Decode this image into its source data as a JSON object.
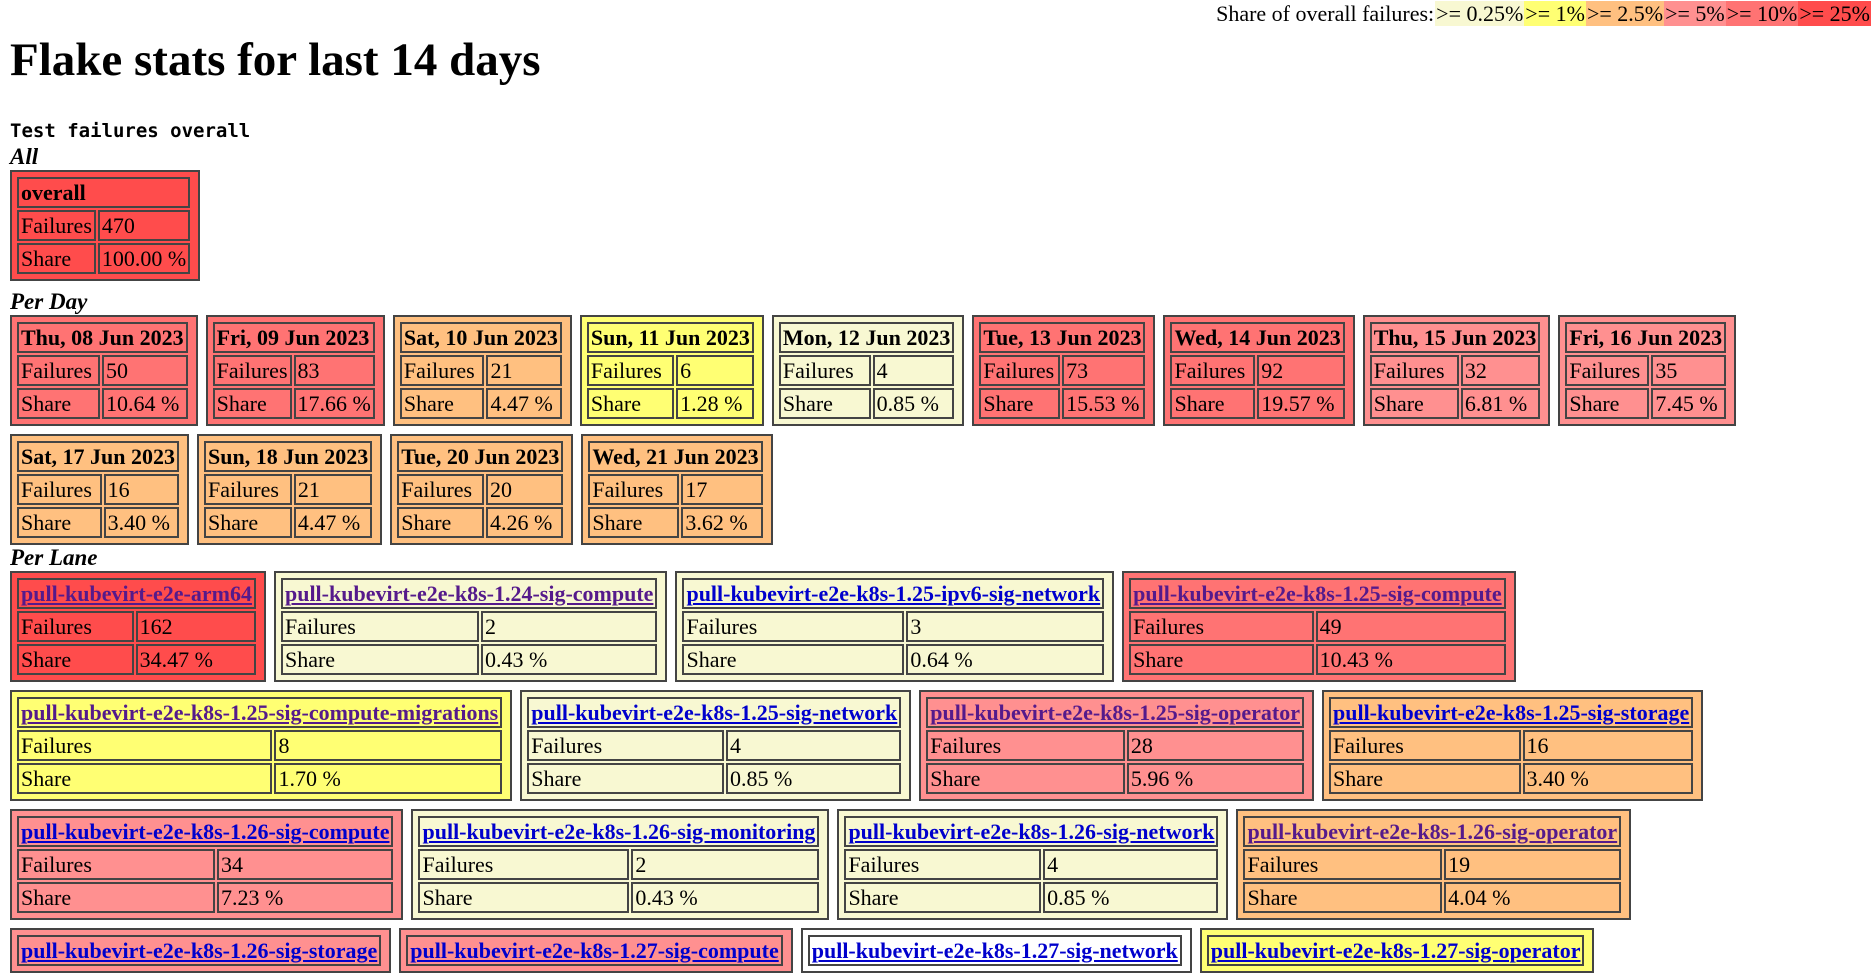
{
  "legend": {
    "label": "Share of overall failures:",
    "items": [
      {
        "label": ">= 0.25%",
        "color": "#f8f8d2"
      },
      {
        "label": ">= 1%",
        "color": "#ffff73"
      },
      {
        "label": ">= 2.5%",
        "color": "#ffc080"
      },
      {
        "label": ">= 5%",
        "color": "#ff9090"
      },
      {
        "label": ">= 10%",
        "color": "#ff7373"
      },
      {
        "label": ">= 25%",
        "color": "#ff4c4c"
      }
    ]
  },
  "title": "Flake stats for last 14 days",
  "subtitle": "Test failures overall",
  "labels": {
    "failures": "Failures",
    "share": "Share"
  },
  "sections": {
    "all": {
      "label": "All",
      "cards": [
        {
          "title": "overall",
          "failures": "470",
          "share": "100.00 %",
          "level": 6
        }
      ]
    },
    "per_day": {
      "label": "Per Day",
      "cards": [
        {
          "title": "Thu, 08 Jun 2023",
          "failures": "50",
          "share": "10.64 %",
          "level": 5
        },
        {
          "title": "Fri, 09 Jun 2023",
          "failures": "83",
          "share": "17.66 %",
          "level": 5
        },
        {
          "title": "Sat, 10 Jun 2023",
          "failures": "21",
          "share": "4.47 %",
          "level": 3
        },
        {
          "title": "Sun, 11 Jun 2023",
          "failures": "6",
          "share": "1.28 %",
          "level": 2
        },
        {
          "title": "Mon, 12 Jun 2023",
          "failures": "4",
          "share": "0.85 %",
          "level": 1
        },
        {
          "title": "Tue, 13 Jun 2023",
          "failures": "73",
          "share": "15.53 %",
          "level": 5
        },
        {
          "title": "Wed, 14 Jun 2023",
          "failures": "92",
          "share": "19.57 %",
          "level": 5
        },
        {
          "title": "Thu, 15 Jun 2023",
          "failures": "32",
          "share": "6.81 %",
          "level": 4
        },
        {
          "title": "Fri, 16 Jun 2023",
          "failures": "35",
          "share": "7.45 %",
          "level": 4
        },
        {
          "title": "Sat, 17 Jun 2023",
          "failures": "16",
          "share": "3.40 %",
          "level": 3
        },
        {
          "title": "Sun, 18 Jun 2023",
          "failures": "21",
          "share": "4.47 %",
          "level": 3
        },
        {
          "title": "Tue, 20 Jun 2023",
          "failures": "20",
          "share": "4.26 %",
          "level": 3
        },
        {
          "title": "Wed, 21 Jun 2023",
          "failures": "17",
          "share": "3.62 %",
          "level": 3
        }
      ]
    },
    "per_lane": {
      "label": "Per Lane",
      "cards": [
        {
          "title": "pull-kubevirt-e2e-arm64",
          "failures": "162",
          "share": "34.47 %",
          "level": 6,
          "visited": true
        },
        {
          "title": "pull-kubevirt-e2e-k8s-1.24-sig-compute",
          "failures": "2",
          "share": "0.43 %",
          "level": 1,
          "visited": true
        },
        {
          "title": "pull-kubevirt-e2e-k8s-1.25-ipv6-sig-network",
          "failures": "3",
          "share": "0.64 %",
          "level": 1,
          "visited": false
        },
        {
          "title": "pull-kubevirt-e2e-k8s-1.25-sig-compute",
          "failures": "49",
          "share": "10.43 %",
          "level": 5,
          "visited": true
        },
        {
          "title": "pull-kubevirt-e2e-k8s-1.25-sig-compute-migrations",
          "failures": "8",
          "share": "1.70 %",
          "level": 2,
          "visited": true
        },
        {
          "title": "pull-kubevirt-e2e-k8s-1.25-sig-network",
          "failures": "4",
          "share": "0.85 %",
          "level": 1,
          "visited": false
        },
        {
          "title": "pull-kubevirt-e2e-k8s-1.25-sig-operator",
          "failures": "28",
          "share": "5.96 %",
          "level": 4,
          "visited": true
        },
        {
          "title": "pull-kubevirt-e2e-k8s-1.25-sig-storage",
          "failures": "16",
          "share": "3.40 %",
          "level": 3,
          "visited": false
        },
        {
          "title": "pull-kubevirt-e2e-k8s-1.26-sig-compute",
          "failures": "34",
          "share": "7.23 %",
          "level": 4,
          "visited": false
        },
        {
          "title": "pull-kubevirt-e2e-k8s-1.26-sig-monitoring",
          "failures": "2",
          "share": "0.43 %",
          "level": 1,
          "visited": false
        },
        {
          "title": "pull-kubevirt-e2e-k8s-1.26-sig-network",
          "failures": "4",
          "share": "0.85 %",
          "level": 1,
          "visited": false
        },
        {
          "title": "pull-kubevirt-e2e-k8s-1.26-sig-operator",
          "failures": "19",
          "share": "4.04 %",
          "level": 3,
          "visited": true
        },
        {
          "title": "pull-kubevirt-e2e-k8s-1.26-sig-storage",
          "level": 4,
          "visited": false
        },
        {
          "title": "pull-kubevirt-e2e-k8s-1.27-sig-compute",
          "level": 4,
          "visited": false
        },
        {
          "title": "pull-kubevirt-e2e-k8s-1.27-sig-network",
          "level": 0,
          "visited": false
        },
        {
          "title": "pull-kubevirt-e2e-k8s-1.27-sig-operator",
          "level": 2,
          "visited": false
        }
      ]
    }
  }
}
